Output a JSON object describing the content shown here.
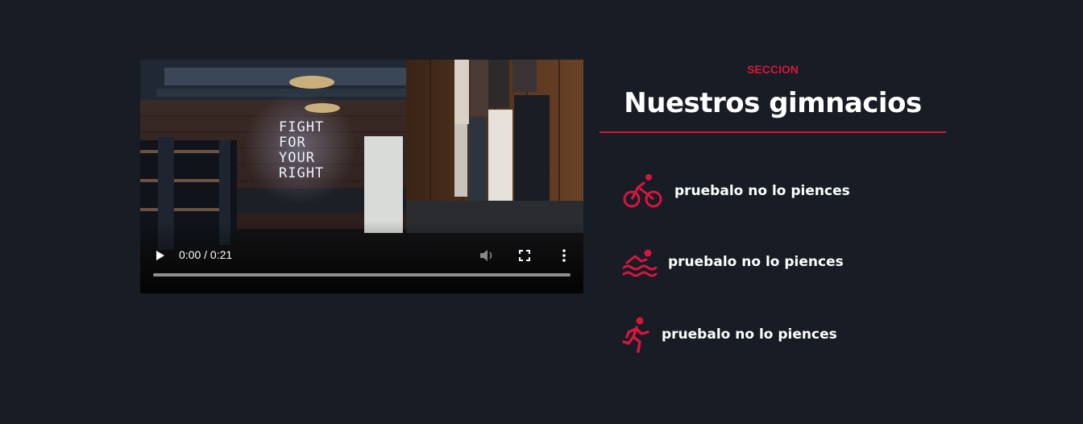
{
  "video": {
    "time_display": "0:00 / 0:21",
    "progress": 0.0,
    "neon_sign": [
      "FIGHT",
      "FOR",
      "YOUR",
      "RIGHT"
    ]
  },
  "section": {
    "label": "SECCION",
    "title": "Nuestros gimnacios"
  },
  "features": [
    {
      "icon": "cycling-icon",
      "text": "pruebalo no lo piences"
    },
    {
      "icon": "swimming-icon",
      "text": "pruebalo no lo piences"
    },
    {
      "icon": "running-icon",
      "text": "pruebalo no lo piences"
    }
  ],
  "colors": {
    "background": "#181c24",
    "accent": "#d7163f",
    "text": "#ffffff"
  }
}
